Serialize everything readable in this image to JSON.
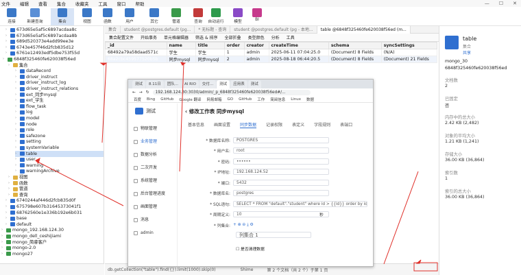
{
  "menu": [
    "文件",
    "编辑",
    "查看",
    "集合",
    "收藏夹",
    "工具",
    "窗口",
    "帮助"
  ],
  "toolbar": {
    "buttons": [
      {
        "label": "连接",
        "color": "#3b78c7"
      },
      {
        "label": "新建查询",
        "color": "#5a8fd6"
      },
      {
        "label": "集合",
        "color": "#3b78c7"
      },
      {
        "label": "视图",
        "color": "#3b78c7"
      },
      {
        "label": "函数",
        "color": "#3b78c7"
      },
      {
        "label": "用户",
        "color": "#3b78c7"
      },
      {
        "label": "其它",
        "color": "#3b78c7"
      },
      {
        "label": "管道",
        "color": "#3a9a4a"
      },
      {
        "label": "查询",
        "color": "#c23a3a"
      },
      {
        "label": "自动运行",
        "color": "#2e9a4c"
      },
      {
        "label": "模型",
        "color": "#8a4ac6"
      },
      {
        "label": "BI",
        "color": "#c63a8c"
      }
    ]
  },
  "tree": {
    "items": [
      {
        "text": "673d65e5af5c6897acdaa8c",
        "indent": 8
      },
      {
        "text": "673d65e5af5c6897acdaa8b",
        "indent": 8
      },
      {
        "text": "689d520373e4add99ee3e",
        "indent": 8
      },
      {
        "text": "6743e457f46d2fcb835d12",
        "indent": 8
      },
      {
        "text": "6761e12493edf5dbe753f55d",
        "indent": 8
      },
      {
        "text": "6848f325460fe620038f56ed",
        "indent": 4
      },
      {
        "text": "集合",
        "indent": 12
      },
      {
        "text": "dataRecord",
        "indent": 22
      },
      {
        "text": "driver_instruct",
        "indent": 22
      },
      {
        "text": "driver_instruct_log",
        "indent": 22
      },
      {
        "text": "driver_instruct_relations",
        "indent": 22
      },
      {
        "text": "ext_同步mysql",
        "indent": 22
      },
      {
        "text": "ext_学生",
        "indent": 22
      },
      {
        "text": "flow_task",
        "indent": 22
      },
      {
        "text": "log",
        "indent": 22
      },
      {
        "text": "model",
        "indent": 22
      },
      {
        "text": "node",
        "indent": 22
      },
      {
        "text": "role",
        "indent": 22
      },
      {
        "text": "safezone",
        "indent": 22
      },
      {
        "text": "setting",
        "indent": 22
      },
      {
        "text": "systemVariable",
        "indent": 22
      },
      {
        "text": "table",
        "indent": 22,
        "selected": true
      },
      {
        "text": "user",
        "indent": 22
      },
      {
        "text": "warning",
        "indent": 22
      },
      {
        "text": "warningArchive",
        "indent": 22
      },
      {
        "text": "视图",
        "indent": 12
      },
      {
        "text": "函数",
        "indent": 12
      },
      {
        "text": "管道",
        "indent": 12
      },
      {
        "text": "查询",
        "indent": 12
      },
      {
        "text": "6740244af446d2fcb835d0f",
        "indent": 8
      },
      {
        "text": "675798e607b31645373041f1",
        "indent": 8
      },
      {
        "text": "68762560e1e336b192e6b031",
        "indent": 8
      },
      {
        "text": "base",
        "indent": 8
      },
      {
        "text": "default",
        "indent": 8
      },
      {
        "text": "mongo_192.168.124.30",
        "indent": 2
      },
      {
        "text": "mongo_dell_ceshijiami",
        "indent": 2
      },
      {
        "text": "mongo_简睿客户",
        "indent": 2
      },
      {
        "text": "mongo-2.0",
        "indent": 2
      },
      {
        "text": "mongo27",
        "indent": 2
      }
    ]
  },
  "tabs": [
    {
      "label": "集合",
      "active": false
    },
    {
      "label": "student @postgres.default (pg...",
      "active": false
    },
    {
      "label": "* 无标题 - 查询",
      "active": false
    },
    {
      "label": "student @postgres.default (pg - 本地...",
      "active": false
    },
    {
      "label": "table @6848f325460fe620038f56ed (m...",
      "active": true
    }
  ],
  "subtoolbar": [
    "集合配置文件",
    "开始事务",
    "单元格编辑器",
    "筛选 & 排序",
    "全部折叠",
    "类型颜色",
    "分析",
    "工具"
  ],
  "grid": {
    "columns": [
      "_id",
      "name",
      "title",
      "order",
      "creator",
      "createTime",
      "schema",
      "syncSettings"
    ],
    "rows": [
      [
        "68492a79a58daad571c",
        "学生",
        "学生",
        "1",
        "admin",
        "2025-06-11 07:04:25.0",
        "(Document) 8 Fields",
        "(N/A)"
      ],
      [
        "68a2cbc459577520b5b",
        "同步mysql",
        "同步mysql",
        "2",
        "admin",
        "2025-08-18 06:44:20.5",
        "(Document) 8 Fields",
        "(Document) 21 Fields"
      ]
    ]
  },
  "rightpane": {
    "title": "table",
    "subtitle": "集合",
    "share": "共享",
    "server": "mongo_30",
    "db": "6848f325460fe620038f56ed",
    "fields": [
      {
        "label": "文档数",
        "value": "2"
      },
      {
        "label": "已固定",
        "value": "否"
      },
      {
        "label": "内存中的总大小",
        "value": "2.42 KB (2,482)"
      },
      {
        "label": "对象的平均大小",
        "value": "1.21 KB (1,241)"
      },
      {
        "label": "存储大小",
        "value": "36.00 KB (36,864)"
      },
      {
        "label": "索引数",
        "value": "1"
      },
      {
        "label": "索引的总大小",
        "value": "36.00 KB (36,864)"
      }
    ]
  },
  "status": {
    "query": "db.getCollection(\"table\").find({}).limit(1000).skip(0)",
    "extra": "Shime",
    "pagination": "第 2 个文档（共 2 个）于第 1 页"
  },
  "browser": {
    "tabs": [
      "测试",
      "8.11日",
      "团队...",
      "AI RIO",
      "交付...",
      "测试",
      "应用表",
      "测试"
    ],
    "url": "192.168.124.30:3030/admin/_p_6848f325460fe620038f56ed#/...",
    "bookmarks": [
      "百度",
      "Bing",
      "GitHub",
      "Google 翻译",
      "网易邮箱",
      "GO",
      "GitHub",
      "工作",
      "简阅信息",
      "Linux",
      "数据"
    ],
    "app_name": "测试",
    "nav": [
      "物联管理",
      "业务管理",
      "数据分析",
      "二次开发",
      "系统管理",
      "后台管理进度",
      "画面管理",
      "消息",
      "admin"
    ],
    "page_title": "修改工作表 同步mysql",
    "subtabs": [
      "基本信息",
      "画面设置",
      "同步数据",
      "记录权限",
      "表定义",
      "字段规则",
      "表端口"
    ],
    "form": [
      {
        "label": "数据库名称",
        "value": "POSTGRES"
      },
      {
        "label": "用户名",
        "value": "root"
      },
      {
        "label": "密码",
        "value": "••••••"
      },
      {
        "label": "IP地址",
        "value": "192.168.124.52"
      },
      {
        "label": "端口",
        "value": "5432"
      },
      {
        "label": "数据库名",
        "value": "postgres"
      },
      {
        "label": "SQL语句",
        "value": "SELECT * FROM \"default\".\"student\" where id > {{id}} order by id asc limit 1"
      },
      {
        "label": "周期定义",
        "value": "10"
      },
      {
        "label": "列集合",
        "value": ""
      }
    ],
    "seconds": "秒",
    "column_set": "列集合 1",
    "checkbox": "是否清理数据"
  },
  "arrow_color": "#e0302a"
}
